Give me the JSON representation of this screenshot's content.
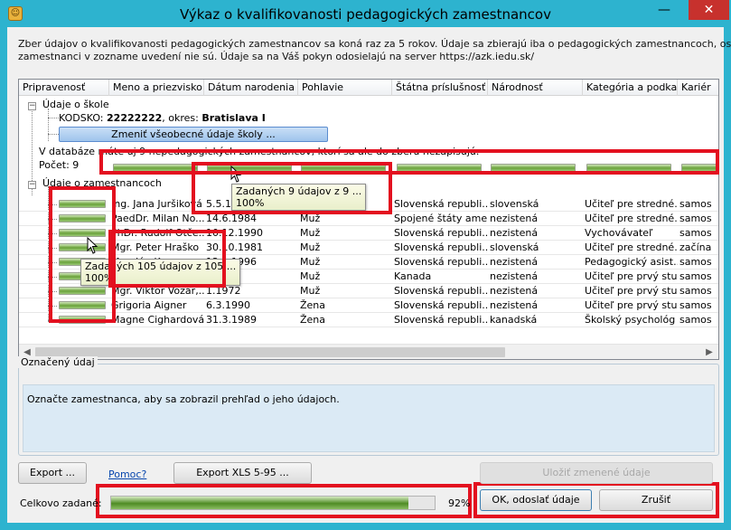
{
  "window": {
    "title": "Výkaz o kvalifikovanosti pedagogických zamestnancov",
    "minimize_glyph": "—",
    "close_glyph": "✕",
    "app_icon_glyph": "☺"
  },
  "intro": {
    "line1": "Zber údajov o kvalifikovanosti pedagogických zamestnancov sa koná raz za 5 rokov. Údaje sa zbierajú iba o pedagogických zamestnancoch, ostatní",
    "line2": "zamestnanci v zozname uvedení nie sú. Údaje sa na Váš pokyn odosielajú na server https://azk.iedu.sk/"
  },
  "columns": [
    "Pripravenosť",
    "Meno a priezvisko",
    "Dátum narodenia",
    "Pohlavie",
    "Štátna príslušnosť",
    "Národnosť",
    "Kategória a podka...",
    "Kariér"
  ],
  "tree": {
    "school_node": "Údaje o škole",
    "kodsko_prefix": "KODSKO: ",
    "kodsko_value": "22222222",
    "okres_prefix": ", okres: ",
    "okres_value": "Bratislava I",
    "change_school_button": "Zmeniť všeobecné údaje školy ...",
    "db_text": "V databáze máte uj 9 nepedagogických zamestnancov, ktorí sa ale do zberu nezapisujú.",
    "count_label": "Počet: 9",
    "employees_node": "Údaje o zamestnancoch"
  },
  "rows": [
    {
      "name": "Ing. Jana Juršiková",
      "dob": "5.5.19",
      "gender": "",
      "citizenship": "Slovenská republi...",
      "nationality": "slovenská",
      "category": "Učiteľ pre stredné...",
      "career": "samos"
    },
    {
      "name": "PaedDr. Milan No...",
      "dob": "14.6.1984",
      "gender": "Muž",
      "citizenship": "Spojené štáty ame...",
      "nationality": "nezistená",
      "category": "Učiteľ pre stredné...",
      "career": "samos"
    },
    {
      "name": "PhDr. Rudolf Otče...",
      "dob": "10.12.1990",
      "gender": "Muž",
      "citizenship": "Slovenská republi...",
      "nationality": "nezistená",
      "category": "Vychovávateľ",
      "career": "samos"
    },
    {
      "name": "Mgr. Peter Hraško",
      "dob": "30.10.1981",
      "gender": "Muž",
      "citizenship": "Slovenská republi...",
      "nationality": "slovenská",
      "category": "Učiteľ pre stredné...",
      "career": "začína"
    },
    {
      "name": "Mgr. Ján Karas",
      "dob": "12.1.1996",
      "gender": "Muž",
      "citizenship": "Slovenská republi...",
      "nationality": "nezistená",
      "category": "Pedagogický asist...",
      "career": "samos"
    },
    {
      "name": "",
      "dob": "1.1950",
      "gender": "Muž",
      "citizenship": "Kanada",
      "nationality": "nezistená",
      "category": "Učiteľ pre prvý stu...",
      "career": "samos"
    },
    {
      "name": "Mgr. Viktor Vozár,...",
      "dob": "1.1972",
      "gender": "Muž",
      "citizenship": "Slovenská republi...",
      "nationality": "nezistená",
      "category": "Učiteľ pre prvý stu...",
      "career": "samos"
    },
    {
      "name": "Grigoria Aigner",
      "dob": "6.3.1990",
      "gender": "Žena",
      "citizenship": "Slovenská republi...",
      "nationality": "nezistená",
      "category": "Učiteľ pre prvý stu...",
      "career": "samos"
    },
    {
      "name": "Magne Cighardová",
      "dob": "31.3.1989",
      "gender": "Žena",
      "citizenship": "Slovenská republi...",
      "nationality": "kanadská",
      "category": "Školský psychológ",
      "career": "samos"
    }
  ],
  "tooltips": {
    "columns_line1": "Zadaných 9 údajov z 9 ...",
    "columns_line2": "100%",
    "rows_line1": "Zadaných 105 údajov z 105 ...",
    "rows_line2": "100%"
  },
  "readiness": {
    "column_fill_pct": 100,
    "row_fill_pct": 100
  },
  "detail": {
    "legend": "Označený údaj",
    "message": "Označte zamestnanca, aby sa zobrazil prehľad o jeho údajoch."
  },
  "buttons": {
    "export": "Export ...",
    "help": "Pomoc?",
    "export_xls": "Export XLS 5-95 ...",
    "save_changes": "Uložiť zmenené údaje",
    "ok_send": "OK, odoslať údaje",
    "cancel": "Zrušiť"
  },
  "total": {
    "label": "Celkovo zadané:",
    "percent_text": "92%",
    "fill_pct": 92
  },
  "colors": {
    "titlebar": "#2db3cf",
    "highlight_box": "#e3101f",
    "progress_green": "#6aa23a",
    "detail_bg": "#dbeaf5"
  },
  "icons": {
    "scroll_left": "◀",
    "scroll_right": "▶",
    "expander_minus": "−"
  }
}
